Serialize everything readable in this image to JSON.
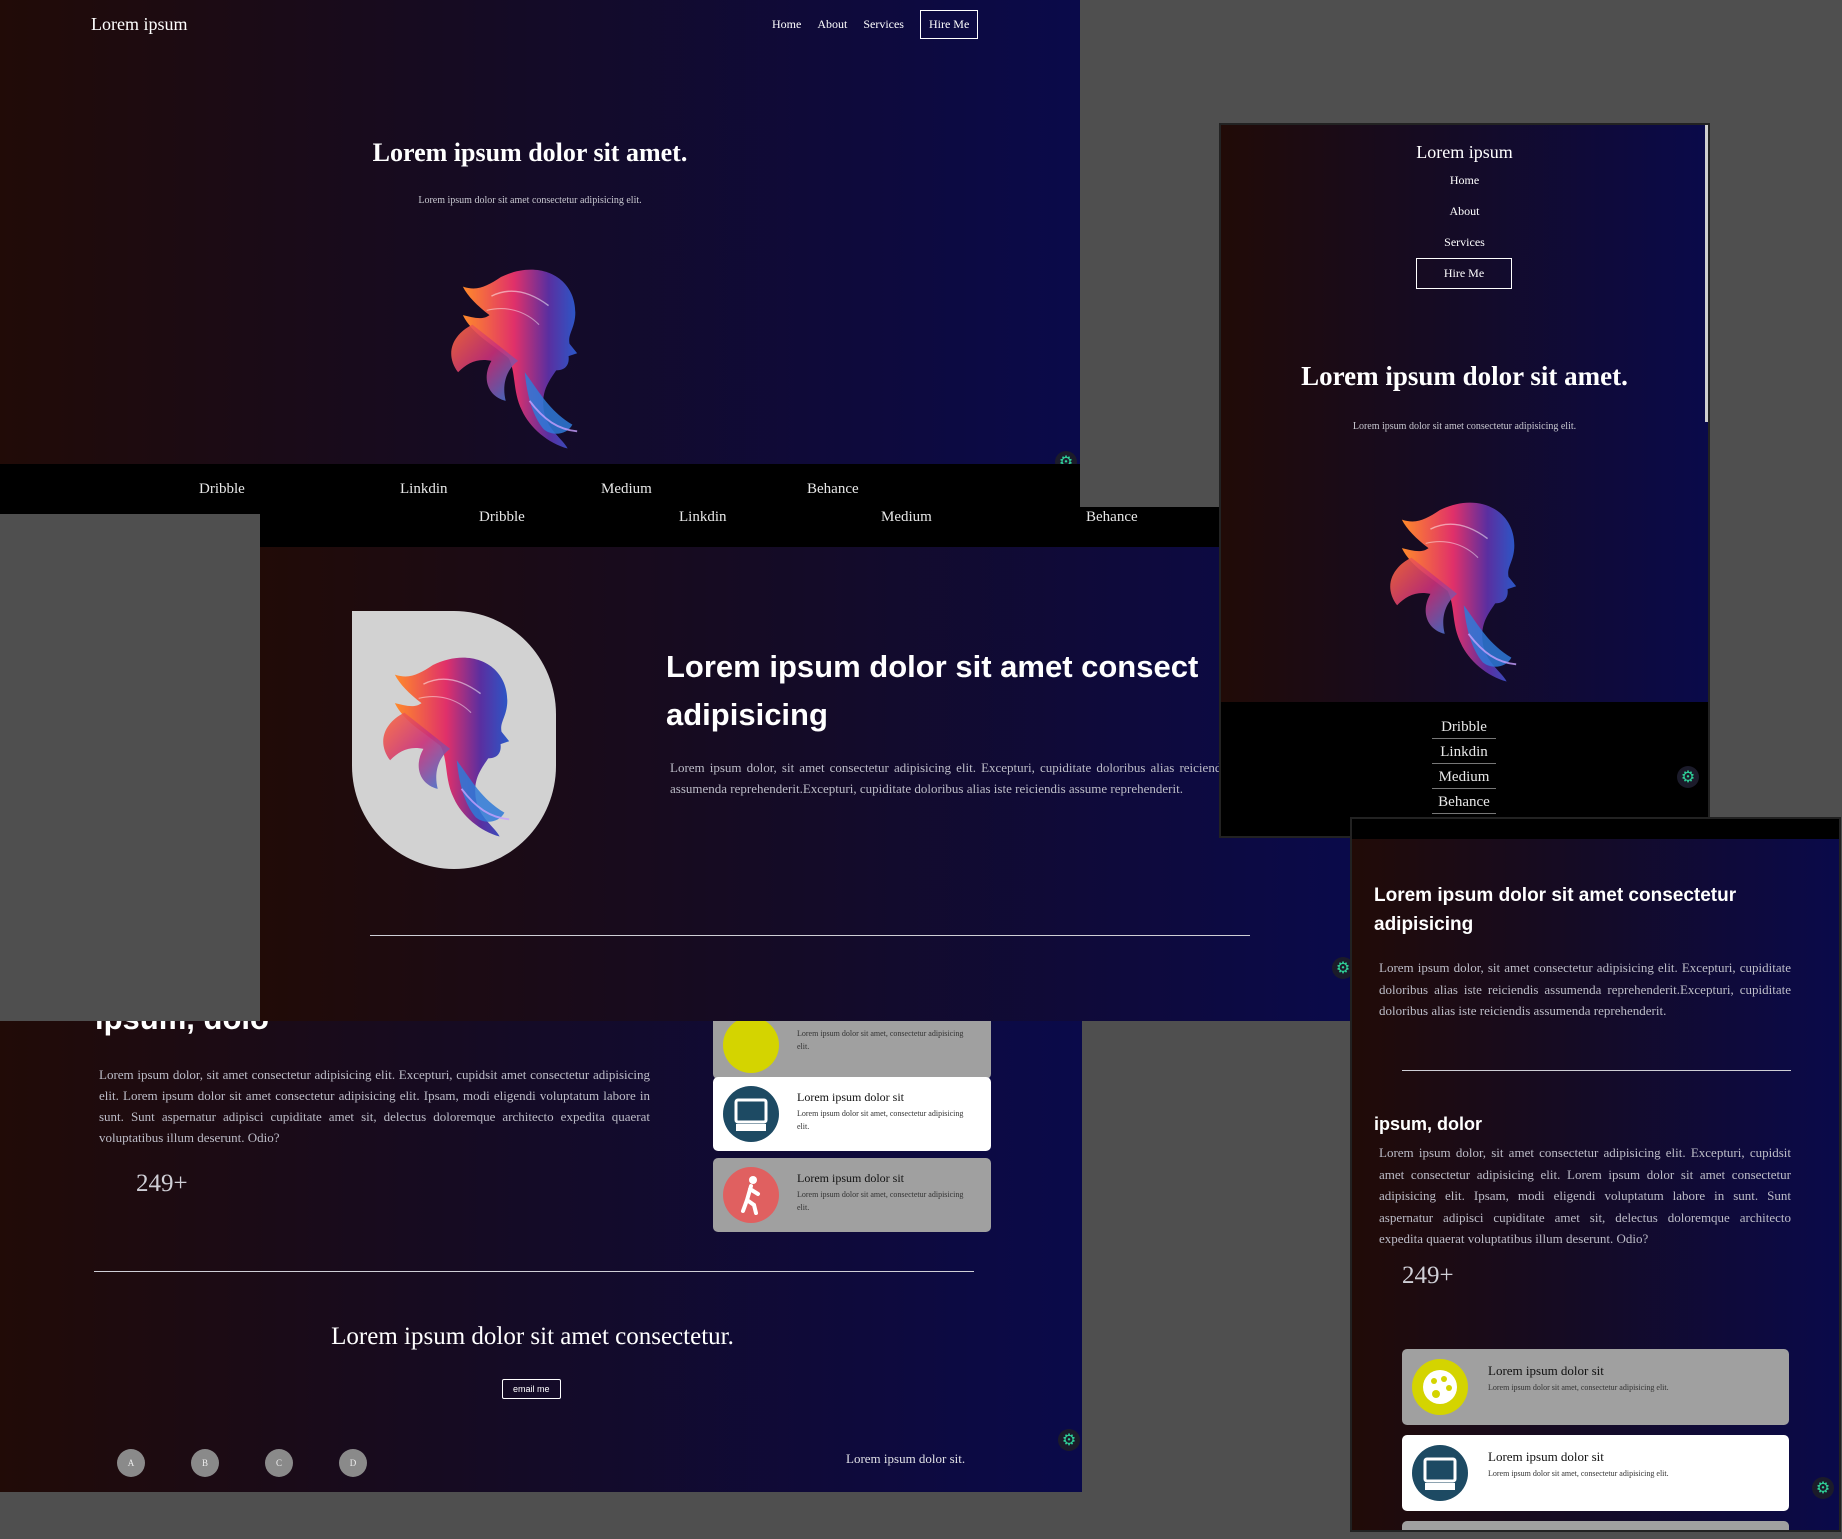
{
  "brand": "Lorem ipsum",
  "nav": {
    "home": "Home",
    "about": "About",
    "services": "Services",
    "hire": "Hire Me"
  },
  "hero": {
    "title": "Lorem ipsum dolor sit amet.",
    "subtitle": "Lorem ipsum dolor sit amet consectetur adipisicing elit."
  },
  "social": [
    "Dribble",
    "Linkdin",
    "Medium",
    "Behance"
  ],
  "about": {
    "title": "Lorem ipsum dolor sit amet consectetur adipisicing",
    "title_cut": "Lorem ipsum dolor sit amet consect",
    "title_line2": "adipisicing",
    "text": "Lorem ipsum dolor, sit amet consectetur adipisicing elit. Excepturi, cupiditate doloribus alias iste reiciendis assumenda reprehenderit.Excepturi, cupiditate doloribus alias iste reiciendis assumenda reprehenderit.",
    "text_cut": "Lorem ipsum dolor, sit amet consectetur adipisicing elit. Excepturi, cupiditate doloribus alias reiciendis assumenda reprehenderit.Excepturi, cupiditate doloribus alias iste reiciendis assume reprehenderit."
  },
  "skills": {
    "title": "ipsum, dolor",
    "title_cut_left": "ipsum, dolo",
    "text": "Lorem ipsum dolor, sit amet consectetur adipisicing elit. Excepturi, cupidsit amet consectetur adipisicing elit. Lorem ipsum dolor sit amet consectetur adipisicing elit. Ipsam, modi eligendi voluptatum labore in sunt. Sunt aspernatur adipisci cupiditate amet sit, delectus doloremque architecto expedita quaerat voluptatibus illum deserunt. Odio?",
    "count": "249+"
  },
  "services": [
    {
      "icon": "palette-icon",
      "title": "Lorem ipsum dolor sit",
      "text": "Lorem ipsum dolor sit amet, consectetur adipisicing elit.",
      "bg": "#a0a0a0",
      "icon_bg": "#d4d400"
    },
    {
      "icon": "monitor-icon",
      "title": "Lorem ipsum dolor sit",
      "text": "Lorem ipsum dolor sit amet, consectetur adipisicing elit.",
      "bg": "#ffffff",
      "icon_bg": "#1d4a63"
    },
    {
      "icon": "walking-icon",
      "title": "Lorem ipsum dolor sit",
      "text": "Lorem ipsum dolor sit amet, consectetur adipisicing elit.",
      "bg": "#a0a0a0",
      "icon_bg": "#e06060"
    }
  ],
  "peek_card_text": "Lorem ipsum dolor sit",
  "contact": {
    "title": "Lorem ipsum dolor sit amet consectetur.",
    "button": "email me",
    "footer": "Lorem ipsum dolor sit."
  },
  "avatars": [
    "A",
    "B",
    "C",
    "D"
  ],
  "colors": {
    "page_bg": "#4f4f4f",
    "gradient_left": "#210b07",
    "gradient_right": "#0a0a4a",
    "accent_green": "#2fd29a"
  }
}
